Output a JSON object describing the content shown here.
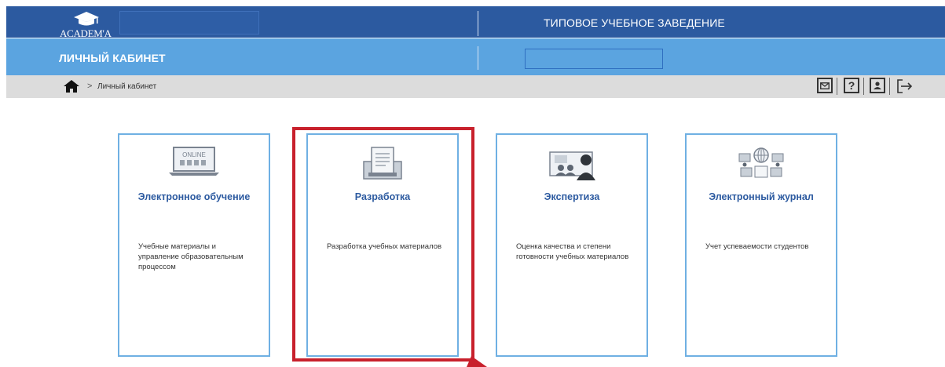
{
  "header": {
    "logo_text": "ACADEM'A",
    "institution": "ТИПОВОЕ УЧЕБНОЕ ЗАВЕДЕНИЕ"
  },
  "subheader": {
    "title": "ЛИЧНЫЙ КАБИНЕТ"
  },
  "breadcrumb": {
    "separator": ">",
    "current": "Личный кабинет"
  },
  "toolbar": {
    "help_symbol": "?"
  },
  "cards": [
    {
      "title": "Электронное обучение",
      "description": "Учебные материалы и управление образовательным процессом",
      "image_label": "ONLINE",
      "icon": "laptop-online-icon"
    },
    {
      "title": "Разработка",
      "description": "Разработка учебных материалов",
      "icon": "document-development-icon"
    },
    {
      "title": "Экспертиза",
      "description": "Оценка качества и степени готовности учебных материалов",
      "icon": "expert-presentation-icon"
    },
    {
      "title": "Электронный журнал",
      "description": "Учет успеваемости студентов",
      "icon": "network-journal-icon"
    }
  ],
  "colors": {
    "header_bg": "#2c5aa0",
    "subheader_bg": "#5ba4e0",
    "breadcrumb_bg": "#dcdcdc",
    "card_border": "#6fb0e3",
    "card_title": "#2c5aa0",
    "highlight": "#c8202c"
  }
}
